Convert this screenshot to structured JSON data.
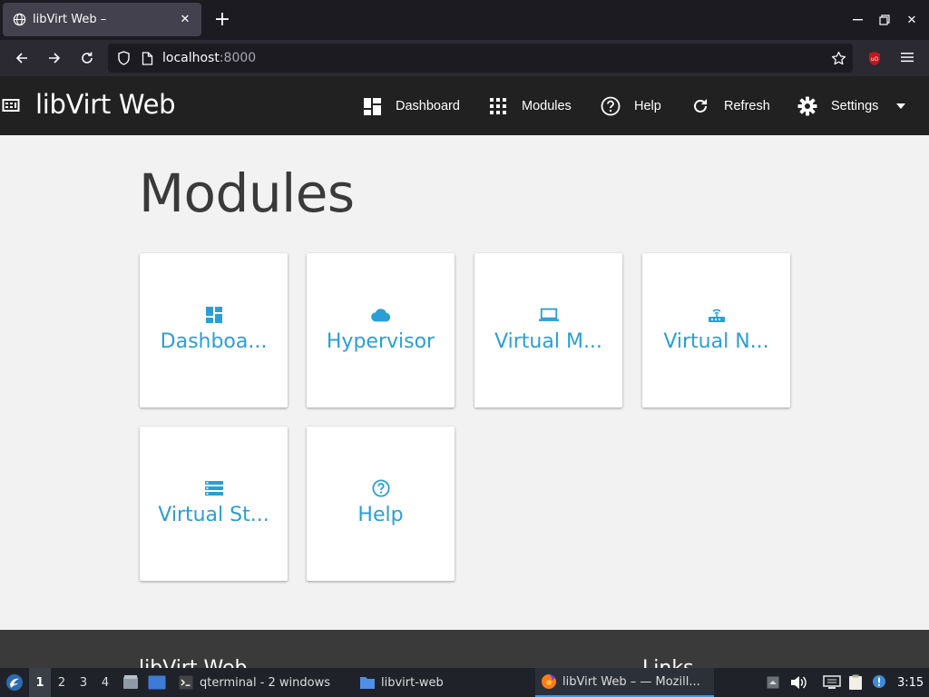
{
  "browser": {
    "tab_title": "libVirt Web –",
    "url_host": "localhost",
    "url_port": ":8000"
  },
  "app": {
    "brand": "libVirt Web",
    "nav": [
      {
        "label": "Dashboard",
        "icon": "dashboard-icon"
      },
      {
        "label": "Modules",
        "icon": "apps-grid-icon"
      },
      {
        "label": "Help",
        "icon": "help-circle-icon"
      },
      {
        "label": "Refresh",
        "icon": "refresh-icon"
      },
      {
        "label": "Settings",
        "icon": "gear-icon"
      }
    ],
    "accent_color": "#2a9fd6",
    "header_color": "#212121"
  },
  "main": {
    "title": "Modules",
    "modules": [
      {
        "label": "Dashboa...",
        "icon": "dashboard-icon"
      },
      {
        "label": "Hypervisor",
        "icon": "cloud-icon"
      },
      {
        "label": "Virtual M...",
        "icon": "laptop-icon"
      },
      {
        "label": "Virtual N...",
        "icon": "router-icon"
      },
      {
        "label": "Virtual St...",
        "icon": "storage-icon"
      },
      {
        "label": "Help",
        "icon": "help-circle-icon"
      }
    ]
  },
  "footer": {
    "title": "libVirt Web",
    "links_heading": "Links"
  },
  "taskbar": {
    "workspaces": [
      "1",
      "2",
      "3",
      "4"
    ],
    "active_workspace": "1",
    "tasks": [
      {
        "label": "qterminal - 2 windows",
        "icon": "terminal-icon"
      },
      {
        "label": "libvirt-web",
        "icon": "folder-icon"
      },
      {
        "label": "libVirt Web – — Mozill...",
        "icon": "firefox-icon"
      }
    ],
    "clock": "3:15"
  }
}
